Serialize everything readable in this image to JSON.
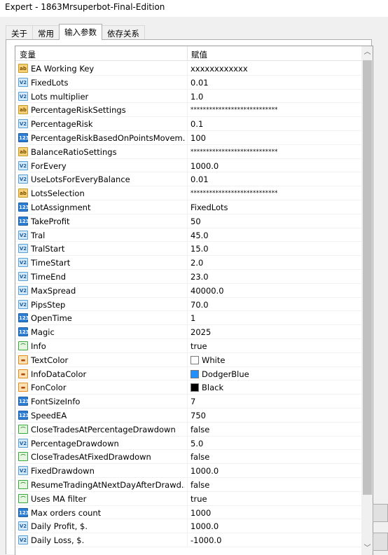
{
  "window": {
    "title": "Expert - 1863Mrsuperbot-Final-Edition"
  },
  "tabs": [
    {
      "label": "关于"
    },
    {
      "label": "常用"
    },
    {
      "label": "输入参数"
    },
    {
      "label": "依存关系"
    }
  ],
  "table": {
    "col_variable": "变量",
    "col_value": "赋值",
    "rows": [
      {
        "icon": "ab",
        "name": "EA Working Key",
        "value": "xxxxxxxxxxxx"
      },
      {
        "icon": "v2",
        "name": "FixedLots",
        "value": "0.01"
      },
      {
        "icon": "v2",
        "name": "Lots multiplier",
        "value": "1.0"
      },
      {
        "icon": "ab",
        "name": "PercentageRiskSettings",
        "value": "****************************"
      },
      {
        "icon": "v2",
        "name": "PercentageRisk",
        "value": "0.1"
      },
      {
        "icon": "n123",
        "name": "PercentageRiskBasedOnPointsMovem...",
        "value": "100"
      },
      {
        "icon": "ab",
        "name": "BalanceRatioSettings",
        "value": "****************************"
      },
      {
        "icon": "v2",
        "name": "ForEvery",
        "value": "1000.0"
      },
      {
        "icon": "v2",
        "name": "UseLotsForEveryBalance",
        "value": "0.01"
      },
      {
        "icon": "ab",
        "name": "LotsSelection",
        "value": "****************************"
      },
      {
        "icon": "n123",
        "name": "LotAssignment",
        "value": "FixedLots"
      },
      {
        "icon": "n123",
        "name": "TakeProfit",
        "value": "50"
      },
      {
        "icon": "v2",
        "name": "Tral",
        "value": "45.0"
      },
      {
        "icon": "v2",
        "name": "TralStart",
        "value": "15.0"
      },
      {
        "icon": "v2",
        "name": "TimeStart",
        "value": "2.0"
      },
      {
        "icon": "v2",
        "name": "TimeEnd",
        "value": "23.0"
      },
      {
        "icon": "v2",
        "name": "MaxSpread",
        "value": "40000.0"
      },
      {
        "icon": "v2",
        "name": "PipsStep",
        "value": "70.0"
      },
      {
        "icon": "n123",
        "name": "OpenTime",
        "value": "1"
      },
      {
        "icon": "n123",
        "name": "Magic",
        "value": "2025"
      },
      {
        "icon": "bool",
        "name": "Info",
        "value": "true"
      },
      {
        "icon": "clr",
        "name": "TextColor",
        "value": "White",
        "swatch": "#ffffff"
      },
      {
        "icon": "clr",
        "name": "InfoDataColor",
        "value": "DodgerBlue",
        "swatch": "#1e90ff"
      },
      {
        "icon": "clr",
        "name": "FonColor",
        "value": "Black",
        "swatch": "#000000"
      },
      {
        "icon": "n123",
        "name": "FontSizeInfo",
        "value": "7"
      },
      {
        "icon": "n123",
        "name": "SpeedEA",
        "value": "750"
      },
      {
        "icon": "bool",
        "name": "CloseTradesAtPercentageDrawdown",
        "value": "false"
      },
      {
        "icon": "v2",
        "name": "PercentageDrawdown",
        "value": "5.0"
      },
      {
        "icon": "bool",
        "name": "CloseTradesAtFixedDrawdown",
        "value": "false"
      },
      {
        "icon": "v2",
        "name": "FixedDrawdown",
        "value": "1000.0"
      },
      {
        "icon": "bool",
        "name": "ResumeTradingAtNextDayAfterDrawd...",
        "value": "false"
      },
      {
        "icon": "bool",
        "name": "Uses MA filter",
        "value": "true"
      },
      {
        "icon": "n123",
        "name": "Max orders count",
        "value": "1000"
      },
      {
        "icon": "v2",
        "name": "Daily Profit, $.",
        "value": "1000.0"
      },
      {
        "icon": "v2",
        "name": "Daily Loss, $.",
        "value": "-1000.0"
      }
    ]
  },
  "icon_glyphs": {
    "ab": "ab",
    "v2": "V2",
    "n123": "123",
    "bool": "⌒",
    "clr": "▬"
  },
  "icon_names": {
    "ab": "string-type-icon",
    "v2": "double-type-icon",
    "n123": "integer-type-icon",
    "bool": "bool-type-icon",
    "clr": "color-type-icon"
  }
}
